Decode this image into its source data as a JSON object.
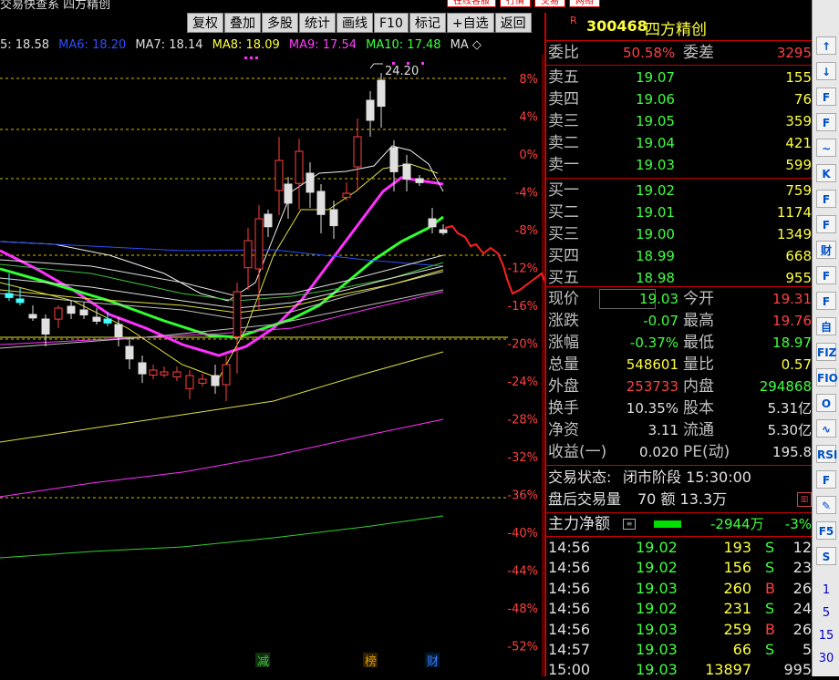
{
  "window_title": "交易快查系 四方精创",
  "top_tabs": [
    "在线客服",
    "行情",
    "交易",
    "网络"
  ],
  "toolbar": [
    "复权",
    "叠加",
    "多股",
    "统计",
    "画线",
    "F10",
    "标记",
    "+自选",
    "返回"
  ],
  "ma_legend": [
    {
      "label": "5: 18.58",
      "color": "#e0e0e0"
    },
    {
      "label": "MA6: 18.20",
      "color": "#2d4fff"
    },
    {
      "label": "MA7: 18.14",
      "color": "#e0e0e0"
    },
    {
      "label": "MA8: 18.09",
      "color": "#ffff40"
    },
    {
      "label": "MA9: 17.54",
      "color": "#ff40ff"
    },
    {
      "label": "MA10: 17.48",
      "color": "#40ff40"
    },
    {
      "label": "MA ◇",
      "color": "#e0e0e0"
    }
  ],
  "chart": {
    "high_label": "24.20",
    "pct_axis": [
      "8%",
      "4%",
      "0%",
      "-4%",
      "-8%",
      "-12%",
      "-16%",
      "-20%",
      "-24%",
      "-28%",
      "-32%",
      "-36%",
      "-40%",
      "-44%",
      "-48%",
      "-52%"
    ],
    "bottom_markers": [
      {
        "label": "减",
        "color": "#40c040"
      },
      {
        "label": "榜",
        "color": "#e0a000"
      },
      {
        "label": "财",
        "color": "#4080ff"
      }
    ]
  },
  "quote": {
    "code": "300468",
    "name": "四方精创",
    "weibi_label": "委比",
    "weibi": "50.58%",
    "weicha_label": "委差",
    "weicha": "3295",
    "asks": [
      {
        "label": "卖五",
        "price": "19.07",
        "vol": "155"
      },
      {
        "label": "卖四",
        "price": "19.06",
        "vol": "76"
      },
      {
        "label": "卖三",
        "price": "19.05",
        "vol": "359"
      },
      {
        "label": "卖二",
        "price": "19.04",
        "vol": "421"
      },
      {
        "label": "卖一",
        "price": "19.03",
        "vol": "599"
      }
    ],
    "bids": [
      {
        "label": "买一",
        "price": "19.02",
        "vol": "759"
      },
      {
        "label": "买二",
        "price": "19.01",
        "vol": "1174"
      },
      {
        "label": "买三",
        "price": "19.00",
        "vol": "1349"
      },
      {
        "label": "买四",
        "price": "18.99",
        "vol": "668"
      },
      {
        "label": "买五",
        "price": "18.98",
        "vol": "955"
      }
    ],
    "stats": [
      {
        "l1": "现价",
        "v1": "19.03",
        "c1": "#40ff40",
        "l2": "今开",
        "v2": "19.31",
        "c2": "#ff4040"
      },
      {
        "l1": "涨跌",
        "v1": "-0.07",
        "c1": "#40ff40",
        "l2": "最高",
        "v2": "19.76",
        "c2": "#ff4040"
      },
      {
        "l1": "涨幅",
        "v1": "-0.37%",
        "c1": "#40ff40",
        "l2": "最低",
        "v2": "18.97",
        "c2": "#40ff40"
      },
      {
        "l1": "总量",
        "v1": "548601",
        "c1": "#ffff40",
        "l2": "量比",
        "v2": "0.57",
        "c2": "#ffff40"
      },
      {
        "l1": "外盘",
        "v1": "253733",
        "c1": "#ff4040",
        "l2": "内盘",
        "v2": "294868",
        "c2": "#40ff40"
      },
      {
        "l1": "换手",
        "v1": "10.35%",
        "c1": "#e0e0e0",
        "l2": "股本",
        "v2": "5.31亿",
        "c2": "#e0e0e0"
      },
      {
        "l1": "净资",
        "v1": "3.11",
        "c1": "#e0e0e0",
        "l2": "流通",
        "v2": "5.30亿",
        "c2": "#e0e0e0"
      },
      {
        "l1": "收益(一)",
        "v1": "0.020",
        "c1": "#e0e0e0",
        "l2": "PE(动)",
        "v2": "195.8",
        "c2": "#e0e0e0"
      }
    ],
    "trade_status_label": "交易状态:",
    "trade_status": "闭市阶段 15:30:00",
    "after_hours_label": "盘后交易量",
    "after_hours": "70 额 13.3万",
    "main_net_label": "主力净额",
    "main_net_value": "-2944万",
    "main_net_pct": "-3%",
    "ticks": [
      {
        "time": "14:56",
        "price": "19.02",
        "vol": "193",
        "bs": "S",
        "n": "12"
      },
      {
        "time": "14:56",
        "price": "19.02",
        "vol": "156",
        "bs": "S",
        "n": "23"
      },
      {
        "time": "14:56",
        "price": "19.03",
        "vol": "260",
        "bs": "B",
        "n": "26"
      },
      {
        "time": "14:56",
        "price": "19.02",
        "vol": "231",
        "bs": "S",
        "n": "24"
      },
      {
        "time": "14:56",
        "price": "19.03",
        "vol": "259",
        "bs": "B",
        "n": "26"
      },
      {
        "time": "14:57",
        "price": "19.03",
        "vol": "66",
        "bs": "S",
        "n": "5"
      },
      {
        "time": "15:00",
        "price": "19.03",
        "vol": "13897",
        "bs": "",
        "n": "995"
      }
    ]
  },
  "right_toolbar": [
    "↑",
    "↓",
    "F",
    "F",
    "∼",
    "K",
    "F",
    "F",
    "财",
    "F",
    "F",
    "自",
    "FIZ",
    "FIO",
    "O",
    "∿",
    "RSI",
    "F",
    "✎",
    "F5",
    "S",
    "1",
    "5",
    "15",
    "30"
  ]
}
